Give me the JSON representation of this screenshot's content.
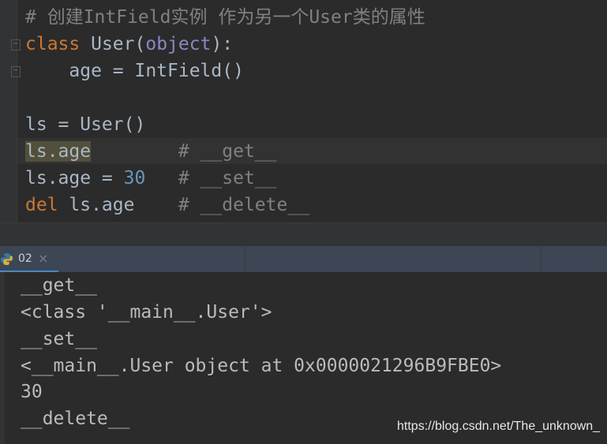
{
  "editor": {
    "comment": "# 创建IntField实例 作为另一个User类的属性",
    "line2": {
      "kw": "class",
      "name": " User(",
      "base": "object",
      "end": "):"
    },
    "line3": "    age = IntField()",
    "line5": "ls = User()",
    "line6": {
      "code": "ls.age",
      "comment": "        # __get__"
    },
    "line7": {
      "code": "ls.age = ",
      "num": "30",
      "comment": "   # __set__"
    },
    "line8": {
      "kw": "del",
      "code": " ls.age",
      "comment": "    # __delete__"
    }
  },
  "run_tab": {
    "icon": "python-icon",
    "label": "02",
    "close": "×"
  },
  "output": [
    "__get__",
    "<class '__main__.User'>",
    "__set__",
    "<__main__.User object at 0x0000021296B9FBE0>",
    "30",
    "__delete__"
  ],
  "watermark": "https://blog.csdn.net/The_unknown_",
  "colors": {
    "keyword": "#cc7832",
    "comment": "#808080",
    "number": "#6897bb",
    "builtin": "#8888c6",
    "text": "#a9b7c6"
  }
}
